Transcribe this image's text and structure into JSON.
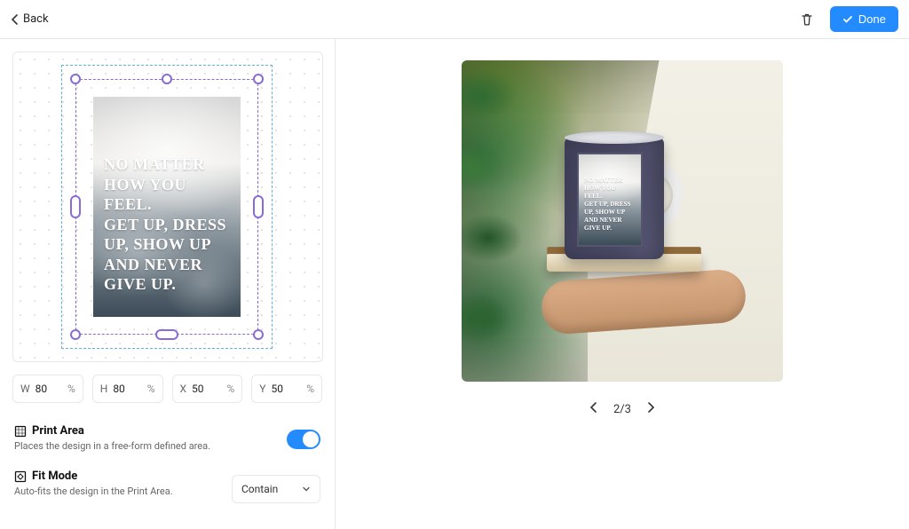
{
  "topbar": {
    "back_label": "Back",
    "done_label": "Done"
  },
  "artwork_text": "NO MATTER\nHOW YOU FEEL.\nGET UP, DRESS\nUP, SHOW UP\nAND NEVER\nGIVE UP.",
  "dims": {
    "w_label": "W",
    "w_value": "80",
    "w_unit": "%",
    "h_label": "H",
    "h_value": "80",
    "h_unit": "%",
    "x_label": "X",
    "x_value": "50",
    "x_unit": "%",
    "y_label": "Y",
    "y_value": "50",
    "y_unit": "%"
  },
  "print_area": {
    "title": "Print Area",
    "desc": "Places the design in a free-form defined area.",
    "enabled": true
  },
  "fit_mode": {
    "title": "Fit Mode",
    "desc": "Auto-fits the design in the Print Area.",
    "value": "Contain"
  },
  "pager": {
    "current": 2,
    "total": 3,
    "label": "2/3"
  },
  "colors": {
    "accent": "#248BFF",
    "selection": "#8a6bd5"
  }
}
